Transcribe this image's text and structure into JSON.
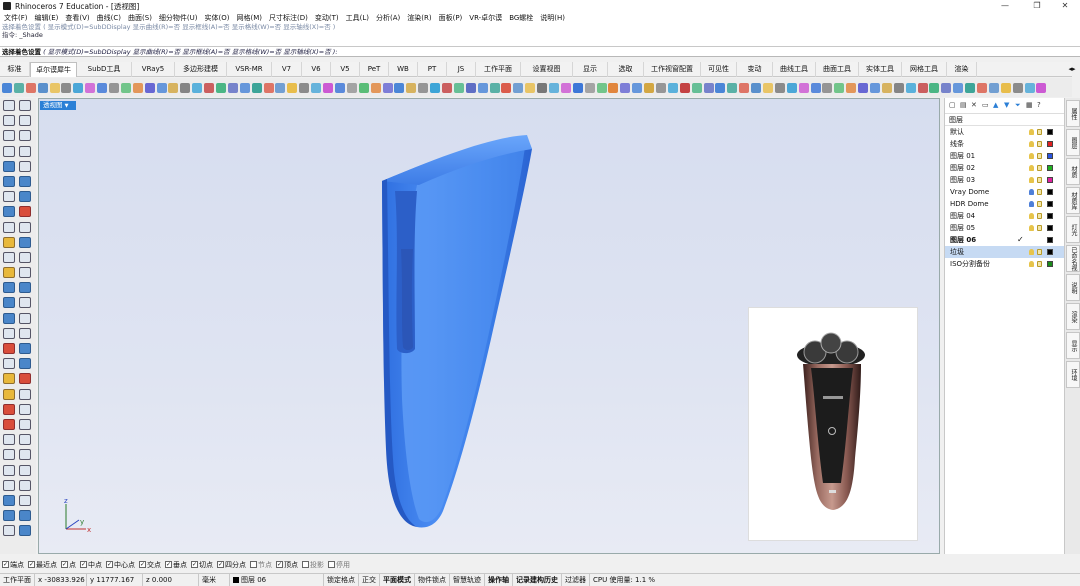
{
  "window": {
    "title": "Rhinoceros 7 Education - [透视图]",
    "minimize": "—",
    "maximize": "❐",
    "close": "✕"
  },
  "menu": [
    "文件(F)",
    "编辑(E)",
    "查看(V)",
    "曲线(C)",
    "曲面(S)",
    "细分物件(U)",
    "实体(O)",
    "网格(M)",
    "尺寸标注(D)",
    "变动(T)",
    "工具(L)",
    "分析(A)",
    "渲染(R)",
    "面板(P)",
    "VR-卓尔谟",
    "BG螺栓",
    "说明(H)"
  ],
  "command": {
    "history1": "选择着色设置 ( 显示模式(D)=SubDDisplay  显示曲线(R)=否  显示框线(A)=否  显示格线(W)=否  显示轴线(X)=否 )",
    "history2_label": "指令:",
    "history2_value": "_Shade",
    "prompt_label": "选择着色设置",
    "prompt_options": "( 显示模式(D)=SubDDisplay  显示曲线(R)=否  显示框线(A)=否  显示格线(W)=否  显示轴线(X)=否 ):"
  },
  "tabs": [
    "标准",
    "卓尔谟犀牛",
    "SubD工具",
    "VRay5",
    "多边形建模",
    "VSR-MR",
    "V7",
    "V6",
    "V5",
    "PeT",
    "WB",
    "PT",
    "JS",
    "工作平面",
    "设置视图",
    "显示",
    "选取",
    "工作视窗配置",
    "可见性",
    "变动",
    "曲线工具",
    "曲面工具",
    "实体工具",
    "网格工具",
    "渲染"
  ],
  "active_tab": "卓尔谟犀牛",
  "viewport": {
    "label": "透视图",
    "dropdown": "▼",
    "axis_x": "x",
    "axis_y": "y",
    "axis_z": "z"
  },
  "layers_panel": {
    "header": "图层",
    "layers": [
      {
        "name": "默认",
        "color": "#000000",
        "bold": false,
        "current": false,
        "selected": false
      },
      {
        "name": "线条",
        "color": "#e02020",
        "bold": false,
        "current": false,
        "selected": false
      },
      {
        "name": "图层 01",
        "color": "#2a55e0",
        "bold": false,
        "current": false,
        "selected": false
      },
      {
        "name": "图层 02",
        "color": "#20b020",
        "bold": false,
        "current": false,
        "selected": false
      },
      {
        "name": "图层 03",
        "color": "#e020a0",
        "bold": false,
        "current": false,
        "selected": false
      },
      {
        "name": "Vray Dome",
        "color": "#000000",
        "bold": false,
        "current": false,
        "selected": false
      },
      {
        "name": "HDR Dome",
        "color": "#000000",
        "bold": false,
        "current": false,
        "selected": false
      },
      {
        "name": "图层 04",
        "color": "#000000",
        "bold": false,
        "current": false,
        "selected": false
      },
      {
        "name": "图层 05",
        "color": "#000000",
        "bold": false,
        "current": false,
        "selected": false
      },
      {
        "name": "图层 06",
        "color": "#000000",
        "bold": true,
        "current": true,
        "selected": false
      },
      {
        "name": "垃圾",
        "color": "#000000",
        "bold": false,
        "current": false,
        "selected": true
      },
      {
        "name": "ISO分割备份",
        "color": "#1a8a1a",
        "bold": false,
        "current": false,
        "selected": false
      }
    ]
  },
  "right_tabs": [
    "属性",
    "图层",
    "材质",
    "材质库",
    "灯光",
    "已命名视图",
    "说明",
    "渲染",
    "显示",
    "环境"
  ],
  "osnap": [
    {
      "label": "端点",
      "checked": true
    },
    {
      "label": "最近点",
      "checked": true
    },
    {
      "label": "点",
      "checked": true
    },
    {
      "label": "中点",
      "checked": true
    },
    {
      "label": "中心点",
      "checked": true
    },
    {
      "label": "交点",
      "checked": true
    },
    {
      "label": "垂点",
      "checked": true
    },
    {
      "label": "切点",
      "checked": true
    },
    {
      "label": "四分点",
      "checked": true
    },
    {
      "label": "节点",
      "checked": false
    },
    {
      "label": "顶点",
      "checked": true
    },
    {
      "label": "投影",
      "checked": false
    },
    {
      "label": "停用",
      "checked": false
    }
  ],
  "status": {
    "cplane": "工作平面",
    "x": "x -30833.926",
    "y": "y 11777.167",
    "z": "z 0.000",
    "unit": "毫米",
    "layer": "图层 06",
    "items": [
      "锁定格点",
      "正交",
      "平面模式",
      "物件锁点",
      "智慧轨迹",
      "操作轴",
      "记录建构历史",
      "过滤器"
    ],
    "bold_items": [
      "平面模式",
      "操作轴",
      "记录建构历史"
    ],
    "cpu": "CPU 使用量: 1.1 %"
  },
  "colors": {
    "viewport_tab": "#2b7fd6",
    "model_blue": "#3f7fe6",
    "selected_layer": "#c6daf3"
  }
}
